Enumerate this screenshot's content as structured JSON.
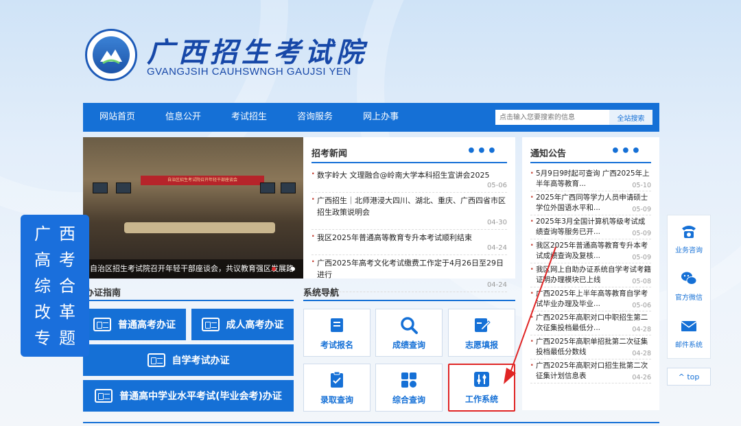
{
  "header": {
    "title": "广西招生考试院",
    "subtitle": "GVANGJSIH CAUHSWNGH GAUJSI YEN"
  },
  "nav": {
    "items": [
      "网站首页",
      "信息公开",
      "考试招生",
      "咨询服务",
      "网上办事"
    ],
    "search_placeholder": "点击输入您要搜索的信息",
    "search_button": "全站搜索"
  },
  "slide": {
    "caption": "自治区招生考试院召开年轻干部座谈会，共议教育强区发展路"
  },
  "news": {
    "title": "招考新闻",
    "items": [
      {
        "text": "数字岭大 文理融合@岭南大学本科招生宣讲会2025",
        "date": "05-06"
      },
      {
        "text": "广西招生｜北师港浸大四川、湖北、重庆、广西四省市区招生政策说明会",
        "date": "04-30"
      },
      {
        "text": "我区2025年普通高等教育专升本考试顺利结束",
        "date": "04-24"
      },
      {
        "text": "广西2025年高考文化考试缴费工作定于4月26日至29日进行",
        "date": "04-24"
      }
    ]
  },
  "notices": {
    "title": "通知公告",
    "items": [
      {
        "text": "5月9日9时起可查询 广西2025年上半年高等教育...",
        "date": "05-10"
      },
      {
        "text": "2025年广西同等学力人员申请硕士学位外国语水平和...",
        "date": "05-09"
      },
      {
        "text": "2025年3月全国计算机等级考试成绩查询等服务已开...",
        "date": "05-09"
      },
      {
        "text": "我区2025年普通高等教育专升本考试成绩查询及复核...",
        "date": "05-09"
      },
      {
        "text": "我区网上自助办证系统自学考试考籍证明办理模块已上线",
        "date": "05-08"
      },
      {
        "text": "广西2025年上半年高等教育自学考试毕业办理及毕业...",
        "date": "05-06"
      },
      {
        "text": "广西2025年高职对口中职招生第二次征集投档最低分...",
        "date": "04-28"
      },
      {
        "text": "广西2025年高职单招批第二次征集投档最低分数线",
        "date": "04-28"
      },
      {
        "text": "广西2025年高职对口招生批第二次征集计划信息表",
        "date": "04-26"
      }
    ]
  },
  "guide": {
    "title": "办证指南",
    "buttons": [
      "普通高考办证",
      "成人高考办证",
      "自学考试办证",
      "普通高中学业水平考试(毕业会考)办证"
    ]
  },
  "system": {
    "title": "系统导航",
    "tiles": [
      "考试报名",
      "成绩查询",
      "志愿填报",
      "录取查询",
      "综合查询",
      "工作系统"
    ]
  },
  "side_banner": {
    "chars": [
      "广",
      "西",
      "高",
      "考",
      "综",
      "合",
      "改",
      "革",
      "专",
      "题"
    ]
  },
  "float": {
    "items": [
      {
        "label": "业务咨询",
        "icon": "phone-icon"
      },
      {
        "label": "官方微信",
        "icon": "wechat-icon"
      },
      {
        "label": "邮件系统",
        "icon": "mail-icon"
      }
    ],
    "top": "^ top"
  },
  "colors": {
    "primary": "#1570d6",
    "highlight": "#e02424",
    "title": "#1748a8"
  }
}
